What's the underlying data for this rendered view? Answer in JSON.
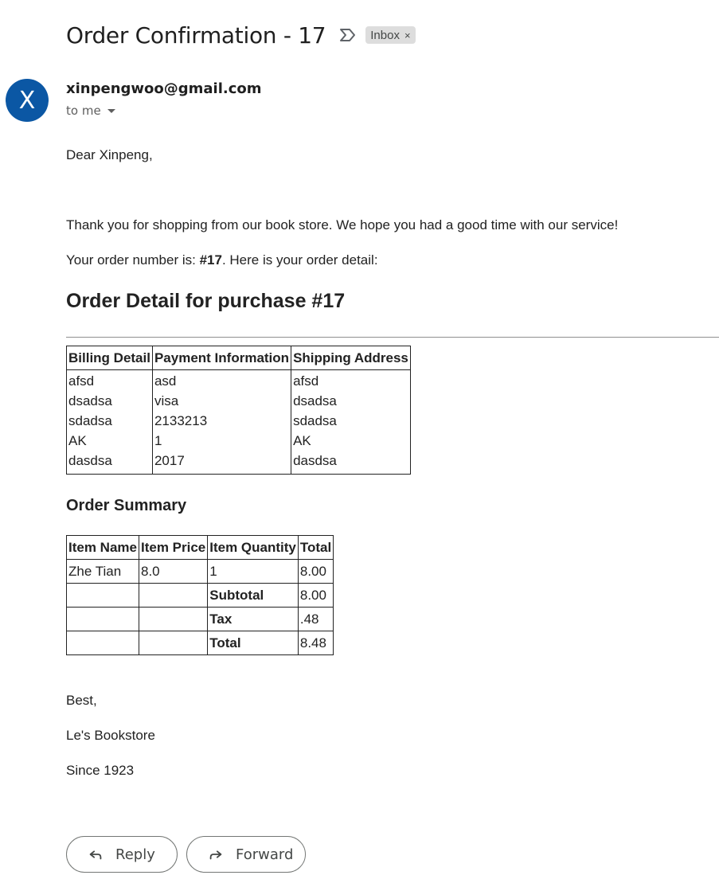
{
  "email": {
    "subject": "Order Confirmation - 17",
    "label_chip": "Inbox",
    "chip_close": "×",
    "avatar_letter": "X",
    "sender": "xinpengwoo@gmail.com",
    "recipient": "to me"
  },
  "message": {
    "greeting": "Dear Xinpeng,",
    "thanks": "Thank you for shopping from our book store. We hope you had a good time with our service!",
    "order_prefix": "Your order number is: ",
    "order_number": "#17",
    "order_suffix": ". Here is your order detail:",
    "detail_heading": "Order Detail for purchase #17",
    "detail_table": {
      "headers": [
        "Billing Detail",
        "Payment Information",
        "Shipping Address"
      ],
      "rows": [
        [
          "afsd",
          "asd",
          "afsd"
        ],
        [
          "dsadsa",
          "visa",
          "dsadsa"
        ],
        [
          "sdadsa",
          "2133213",
          "sdadsa"
        ],
        [
          "AK",
          "1",
          "AK"
        ],
        [
          "dasdsa",
          "2017",
          "dasdsa"
        ]
      ]
    },
    "summary_heading": "Order Summary",
    "summary_table": {
      "headers": [
        "Item Name",
        "Item Price",
        "Item Quantity",
        "Total"
      ],
      "item": [
        "Zhe Tian",
        "8.0",
        "1",
        "8.00"
      ],
      "subtotal_label": "Subtotal",
      "subtotal_value": "8.00",
      "tax_label": "Tax",
      "tax_value": ".48",
      "total_label": "Total",
      "total_value": "8.48"
    },
    "signoff": "Best,",
    "store_name": "Le's Bookstore",
    "since": "Since 1923"
  },
  "actions": {
    "reply_label": "Reply",
    "forward_label": "Forward"
  },
  "icons": {
    "important": "important-marker-icon",
    "reply": "reply-arrow-icon",
    "forward": "forward-arrow-icon",
    "caret": "caret-down-icon"
  },
  "colors": {
    "avatar_bg": "#0b57a4",
    "chip_bg": "#dddddd",
    "text": "#222222"
  }
}
